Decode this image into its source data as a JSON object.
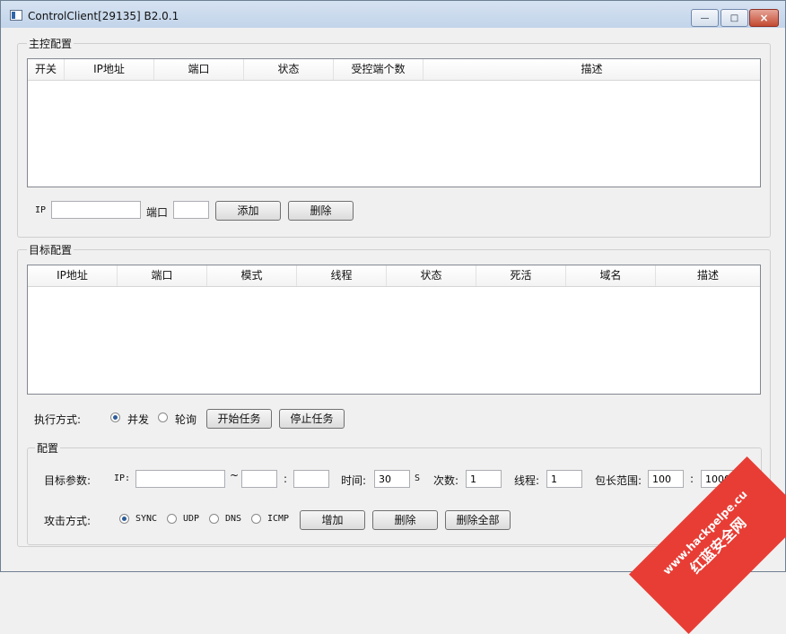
{
  "window": {
    "title": "ControlClient[29135] B2.0.1"
  },
  "master": {
    "group_title": "主控配置",
    "columns": [
      "开关",
      "IP地址",
      "端口",
      "状态",
      "受控端个数",
      "描述"
    ],
    "ip_label": "IP",
    "port_label": "端口",
    "add_label": "添加",
    "delete_label": "删除"
  },
  "target": {
    "group_title": "目标配置",
    "columns": [
      "IP地址",
      "端口",
      "模式",
      "线程",
      "状态",
      "死活",
      "域名",
      "描述"
    ],
    "exec_label": "执行方式:",
    "mode_concurrent": "并发",
    "mode_polling": "轮询",
    "start_label": "开始任务",
    "stop_label": "停止任务"
  },
  "config": {
    "group_title": "配置",
    "target_params_label": "目标参数:",
    "ip_label": "IP:",
    "tilde": "~",
    "colon": ":",
    "time_label": "时间:",
    "time_value": "30",
    "time_unit": "S",
    "count_label": "次数:",
    "count_value": "1",
    "thread_label": "线程:",
    "thread_value": "1",
    "packet_label": "包长范围:",
    "packet_min": "100",
    "packet_max": "1000",
    "attack_label": "攻击方式:",
    "methods": [
      "SYNC",
      "UDP",
      "DNS",
      "ICMP"
    ],
    "add_label": "增加",
    "delete_label": "删除",
    "delete_all_label": "删除全部"
  },
  "watermark": {
    "url": "www.hackpelpe.cu",
    "name": "红蓝安全网"
  }
}
